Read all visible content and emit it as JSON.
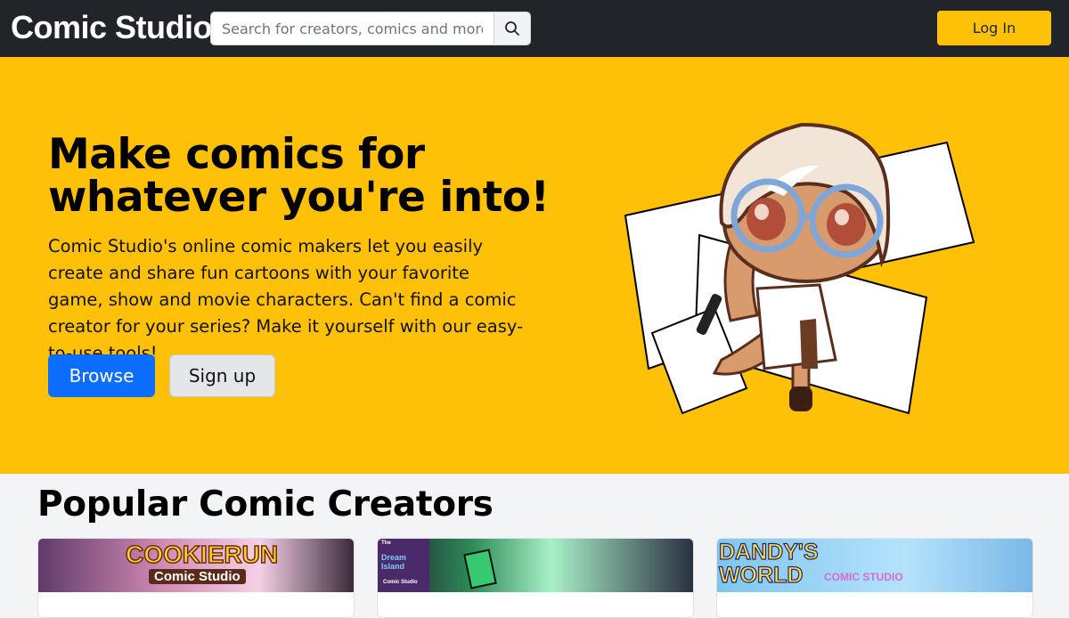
{
  "navbar": {
    "logo": "Comic Studio",
    "search_placeholder": "Search for creators, comics and more",
    "search_button_icon": "search-icon",
    "login_label": "Log In"
  },
  "hero": {
    "title_line1": "Make comics for",
    "title_line2": "whatever you're into!",
    "description": "Comic Studio's online comic makers let you easily create and share fun cartoons with your favorite game, show and movie characters. Can't find a comic creator for your series? Make it yourself with our easy-to-use tools!",
    "browse_label": "Browse",
    "signup_label": "Sign up"
  },
  "popular": {
    "title": "Popular Comic Creators",
    "cards": [
      {
        "banner_title": "COOKIERUN",
        "banner_subtitle": "Comic Studio"
      },
      {
        "banner_title": "Dream Island",
        "banner_small": "The",
        "banner_subtitle": "Comic Studio"
      },
      {
        "banner_title": "DANDY'S WORLD",
        "banner_subtitle": "COMIC STUDIO"
      }
    ]
  },
  "colors": {
    "navbar_bg": "#212529",
    "accent_yellow": "#ffc107",
    "primary_blue": "#0d6efd"
  }
}
